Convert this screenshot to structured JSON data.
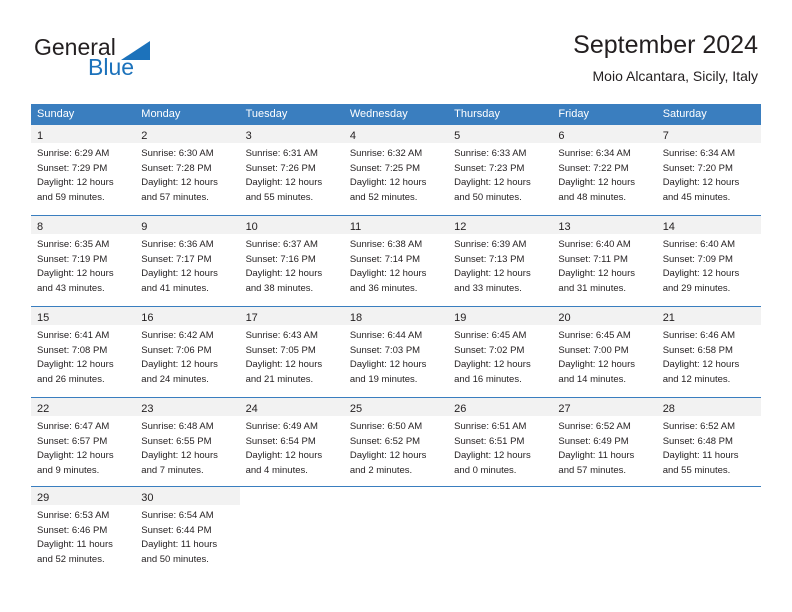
{
  "brand": {
    "name_part1": "General",
    "name_part2": "Blue",
    "accent_color": "#1c72bb",
    "logo_icon": "triangle-flag-icon"
  },
  "header": {
    "title": "September 2024",
    "location": "Moio Alcantara, Sicily, Italy"
  },
  "calendar": {
    "header_bg": "#3a7ebf",
    "daynum_band_bg": "#f2f2f2",
    "weekday_headers": [
      "Sunday",
      "Monday",
      "Tuesday",
      "Wednesday",
      "Thursday",
      "Friday",
      "Saturday"
    ],
    "weeks": [
      [
        {
          "day": "1",
          "sunrise": "Sunrise: 6:29 AM",
          "sunset": "Sunset: 7:29 PM",
          "daylight1": "Daylight: 12 hours",
          "daylight2": "and 59 minutes."
        },
        {
          "day": "2",
          "sunrise": "Sunrise: 6:30 AM",
          "sunset": "Sunset: 7:28 PM",
          "daylight1": "Daylight: 12 hours",
          "daylight2": "and 57 minutes."
        },
        {
          "day": "3",
          "sunrise": "Sunrise: 6:31 AM",
          "sunset": "Sunset: 7:26 PM",
          "daylight1": "Daylight: 12 hours",
          "daylight2": "and 55 minutes."
        },
        {
          "day": "4",
          "sunrise": "Sunrise: 6:32 AM",
          "sunset": "Sunset: 7:25 PM",
          "daylight1": "Daylight: 12 hours",
          "daylight2": "and 52 minutes."
        },
        {
          "day": "5",
          "sunrise": "Sunrise: 6:33 AM",
          "sunset": "Sunset: 7:23 PM",
          "daylight1": "Daylight: 12 hours",
          "daylight2": "and 50 minutes."
        },
        {
          "day": "6",
          "sunrise": "Sunrise: 6:34 AM",
          "sunset": "Sunset: 7:22 PM",
          "daylight1": "Daylight: 12 hours",
          "daylight2": "and 48 minutes."
        },
        {
          "day": "7",
          "sunrise": "Sunrise: 6:34 AM",
          "sunset": "Sunset: 7:20 PM",
          "daylight1": "Daylight: 12 hours",
          "daylight2": "and 45 minutes."
        }
      ],
      [
        {
          "day": "8",
          "sunrise": "Sunrise: 6:35 AM",
          "sunset": "Sunset: 7:19 PM",
          "daylight1": "Daylight: 12 hours",
          "daylight2": "and 43 minutes."
        },
        {
          "day": "9",
          "sunrise": "Sunrise: 6:36 AM",
          "sunset": "Sunset: 7:17 PM",
          "daylight1": "Daylight: 12 hours",
          "daylight2": "and 41 minutes."
        },
        {
          "day": "10",
          "sunrise": "Sunrise: 6:37 AM",
          "sunset": "Sunset: 7:16 PM",
          "daylight1": "Daylight: 12 hours",
          "daylight2": "and 38 minutes."
        },
        {
          "day": "11",
          "sunrise": "Sunrise: 6:38 AM",
          "sunset": "Sunset: 7:14 PM",
          "daylight1": "Daylight: 12 hours",
          "daylight2": "and 36 minutes."
        },
        {
          "day": "12",
          "sunrise": "Sunrise: 6:39 AM",
          "sunset": "Sunset: 7:13 PM",
          "daylight1": "Daylight: 12 hours",
          "daylight2": "and 33 minutes."
        },
        {
          "day": "13",
          "sunrise": "Sunrise: 6:40 AM",
          "sunset": "Sunset: 7:11 PM",
          "daylight1": "Daylight: 12 hours",
          "daylight2": "and 31 minutes."
        },
        {
          "day": "14",
          "sunrise": "Sunrise: 6:40 AM",
          "sunset": "Sunset: 7:09 PM",
          "daylight1": "Daylight: 12 hours",
          "daylight2": "and 29 minutes."
        }
      ],
      [
        {
          "day": "15",
          "sunrise": "Sunrise: 6:41 AM",
          "sunset": "Sunset: 7:08 PM",
          "daylight1": "Daylight: 12 hours",
          "daylight2": "and 26 minutes."
        },
        {
          "day": "16",
          "sunrise": "Sunrise: 6:42 AM",
          "sunset": "Sunset: 7:06 PM",
          "daylight1": "Daylight: 12 hours",
          "daylight2": "and 24 minutes."
        },
        {
          "day": "17",
          "sunrise": "Sunrise: 6:43 AM",
          "sunset": "Sunset: 7:05 PM",
          "daylight1": "Daylight: 12 hours",
          "daylight2": "and 21 minutes."
        },
        {
          "day": "18",
          "sunrise": "Sunrise: 6:44 AM",
          "sunset": "Sunset: 7:03 PM",
          "daylight1": "Daylight: 12 hours",
          "daylight2": "and 19 minutes."
        },
        {
          "day": "19",
          "sunrise": "Sunrise: 6:45 AM",
          "sunset": "Sunset: 7:02 PM",
          "daylight1": "Daylight: 12 hours",
          "daylight2": "and 16 minutes."
        },
        {
          "day": "20",
          "sunrise": "Sunrise: 6:45 AM",
          "sunset": "Sunset: 7:00 PM",
          "daylight1": "Daylight: 12 hours",
          "daylight2": "and 14 minutes."
        },
        {
          "day": "21",
          "sunrise": "Sunrise: 6:46 AM",
          "sunset": "Sunset: 6:58 PM",
          "daylight1": "Daylight: 12 hours",
          "daylight2": "and 12 minutes."
        }
      ],
      [
        {
          "day": "22",
          "sunrise": "Sunrise: 6:47 AM",
          "sunset": "Sunset: 6:57 PM",
          "daylight1": "Daylight: 12 hours",
          "daylight2": "and 9 minutes."
        },
        {
          "day": "23",
          "sunrise": "Sunrise: 6:48 AM",
          "sunset": "Sunset: 6:55 PM",
          "daylight1": "Daylight: 12 hours",
          "daylight2": "and 7 minutes."
        },
        {
          "day": "24",
          "sunrise": "Sunrise: 6:49 AM",
          "sunset": "Sunset: 6:54 PM",
          "daylight1": "Daylight: 12 hours",
          "daylight2": "and 4 minutes."
        },
        {
          "day": "25",
          "sunrise": "Sunrise: 6:50 AM",
          "sunset": "Sunset: 6:52 PM",
          "daylight1": "Daylight: 12 hours",
          "daylight2": "and 2 minutes."
        },
        {
          "day": "26",
          "sunrise": "Sunrise: 6:51 AM",
          "sunset": "Sunset: 6:51 PM",
          "daylight1": "Daylight: 12 hours",
          "daylight2": "and 0 minutes."
        },
        {
          "day": "27",
          "sunrise": "Sunrise: 6:52 AM",
          "sunset": "Sunset: 6:49 PM",
          "daylight1": "Daylight: 11 hours",
          "daylight2": "and 57 minutes."
        },
        {
          "day": "28",
          "sunrise": "Sunrise: 6:52 AM",
          "sunset": "Sunset: 6:48 PM",
          "daylight1": "Daylight: 11 hours",
          "daylight2": "and 55 minutes."
        }
      ],
      [
        {
          "day": "29",
          "sunrise": "Sunrise: 6:53 AM",
          "sunset": "Sunset: 6:46 PM",
          "daylight1": "Daylight: 11 hours",
          "daylight2": "and 52 minutes."
        },
        {
          "day": "30",
          "sunrise": "Sunrise: 6:54 AM",
          "sunset": "Sunset: 6:44 PM",
          "daylight1": "Daylight: 11 hours",
          "daylight2": "and 50 minutes."
        },
        {
          "day": "",
          "sunrise": "",
          "sunset": "",
          "daylight1": "",
          "daylight2": ""
        },
        {
          "day": "",
          "sunrise": "",
          "sunset": "",
          "daylight1": "",
          "daylight2": ""
        },
        {
          "day": "",
          "sunrise": "",
          "sunset": "",
          "daylight1": "",
          "daylight2": ""
        },
        {
          "day": "",
          "sunrise": "",
          "sunset": "",
          "daylight1": "",
          "daylight2": ""
        },
        {
          "day": "",
          "sunrise": "",
          "sunset": "",
          "daylight1": "",
          "daylight2": ""
        }
      ]
    ]
  }
}
